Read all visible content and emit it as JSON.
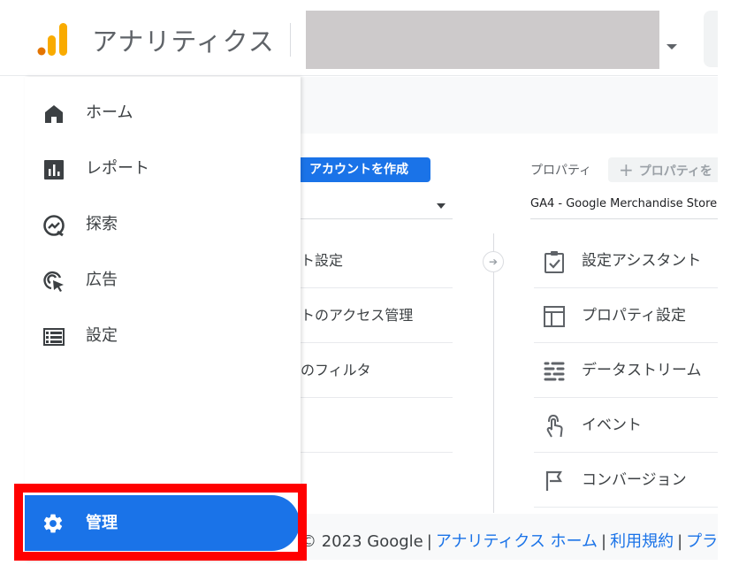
{
  "header": {
    "app_title": "アナリティクス"
  },
  "account": {
    "create_button": "アカウントを作成",
    "items": [
      {
        "label": "アカウント設定",
        "visible_label": "ト設定"
      },
      {
        "label": "アカウントのアクセス管理",
        "visible_label": "トのアクセス管理"
      },
      {
        "label": "すべてのフィルタ",
        "visible_label": "のフィルタ"
      }
    ]
  },
  "property": {
    "label": "プロパティ",
    "create_button": "プロパティを作成",
    "create_button_visible": "プロパティを",
    "selected": "GA4 - Google Merchandise Store",
    "items": [
      {
        "icon": "checklist-icon",
        "label": "設定アシスタント"
      },
      {
        "icon": "property-settings-icon",
        "label": "プロパティ設定"
      },
      {
        "icon": "data-streams-icon",
        "label": "データストリーム"
      },
      {
        "icon": "touch-icon",
        "label": "イベント"
      },
      {
        "icon": "flag-icon",
        "label": "コンバージョン"
      }
    ]
  },
  "nav": {
    "items": [
      {
        "icon": "home-icon",
        "label": "ホーム"
      },
      {
        "icon": "reports-icon",
        "label": "レポート"
      },
      {
        "icon": "explore-icon",
        "label": "探索"
      },
      {
        "icon": "advertising-icon",
        "label": "広告"
      },
      {
        "icon": "configure-icon",
        "label": "設定"
      }
    ],
    "admin": {
      "icon": "gear-icon",
      "label": "管理"
    }
  },
  "footer": {
    "copyright": "© 2023 Google",
    "links": [
      "アナリティクス ホーム",
      "利用規約",
      "プライバシー"
    ]
  },
  "colors": {
    "accent": "#1a73e8",
    "highlight": "#ff0000",
    "logo_orange": "#f9ab00",
    "logo_dark_orange": "#e37400"
  }
}
